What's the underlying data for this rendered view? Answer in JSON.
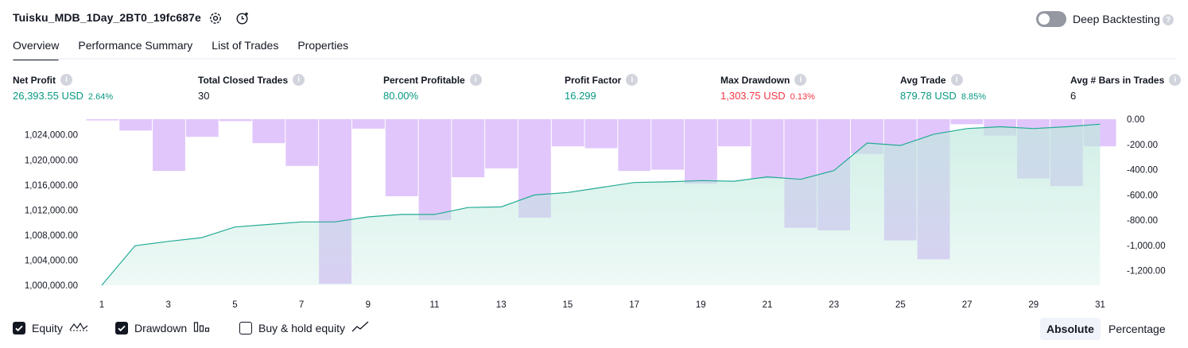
{
  "header": {
    "title": "Tuisku_MDB_1Day_2BT0_19fc687e",
    "deep_backtesting_label": "Deep Backtesting",
    "deep_backtesting_enabled": false
  },
  "tabs": [
    {
      "label": "Overview",
      "active": true
    },
    {
      "label": "Performance Summary",
      "active": false
    },
    {
      "label": "List of Trades",
      "active": false
    },
    {
      "label": "Properties",
      "active": false
    }
  ],
  "metrics": {
    "net_profit": {
      "label": "Net Profit",
      "value": "26,393.55 USD",
      "sub": "2.64%"
    },
    "total_closed_trades": {
      "label": "Total Closed Trades",
      "value": "30"
    },
    "percent_profitable": {
      "label": "Percent Profitable",
      "value": "80.00%"
    },
    "profit_factor": {
      "label": "Profit Factor",
      "value": "16.299"
    },
    "max_drawdown": {
      "label": "Max Drawdown",
      "value": "1,303.75 USD",
      "sub": "0.13%"
    },
    "avg_trade": {
      "label": "Avg Trade",
      "value": "879.78 USD",
      "sub": "8.85%"
    },
    "avg_bars": {
      "label": "Avg # Bars in Trades",
      "value": "6"
    }
  },
  "colors": {
    "equity_line": "#22ab94",
    "equity_fill_top": "#bfe9dd",
    "drawdown_bar": "#e1c6fb",
    "positive": "#089981",
    "negative": "#f23645"
  },
  "chart_data": {
    "type": "line",
    "x": [
      1,
      2,
      3,
      4,
      5,
      6,
      7,
      8,
      9,
      10,
      11,
      12,
      13,
      14,
      15,
      16,
      17,
      18,
      19,
      20,
      21,
      22,
      23,
      24,
      25,
      26,
      27,
      28,
      29,
      30,
      31
    ],
    "xticks": [
      "1",
      "3",
      "5",
      "7",
      "9",
      "11",
      "13",
      "15",
      "17",
      "19",
      "21",
      "23",
      "25",
      "27",
      "29",
      "31"
    ],
    "series": [
      {
        "axis": "left",
        "kind": "area-line",
        "values": [
          1000000,
          1006300,
          1007000,
          1007600,
          1009300,
          1009700,
          1010100,
          1010100,
          1010900,
          1011300,
          1011300,
          1012400,
          1012500,
          1014400,
          1014800,
          1015600,
          1016400,
          1016500,
          1016700,
          1016600,
          1017300,
          1016900,
          1018300,
          1022700,
          1022300,
          1024100,
          1025000,
          1025300,
          1025000,
          1025300,
          1025700
        ]
      },
      {
        "axis": "right",
        "kind": "bar",
        "values": [
          -10,
          -90,
          -410,
          -140,
          -15,
          -190,
          -370,
          -1303.75,
          -75,
          -610,
          -800,
          -460,
          -390,
          -780,
          -215,
          -230,
          -410,
          -400,
          -510,
          -215,
          -470,
          -860,
          -880,
          -275,
          -960,
          -1110,
          -40,
          -130,
          -470,
          -530,
          -215
        ]
      }
    ],
    "yticks_left": [
      "1,000,000.00",
      "1,004,000.00",
      "1,008,000.00",
      "1,012,000.00",
      "1,016,000.00",
      "1,020,000.00",
      "1,024,000.00"
    ],
    "ylim_left": [
      1000000,
      1026500
    ],
    "yticks_right": [
      "0.00",
      "-200.00",
      "-400.00",
      "-600.00",
      "-800.00",
      "-1,000.00",
      "-1,200.00"
    ],
    "ylim_right": [
      -1315,
      0
    ]
  },
  "legend": {
    "equity": {
      "label": "Equity",
      "checked": true
    },
    "drawdown": {
      "label": "Drawdown",
      "checked": true
    },
    "buy_hold": {
      "label": "Buy & hold equity",
      "checked": false
    }
  },
  "view_toggle": {
    "absolute": "Absolute",
    "percentage": "Percentage",
    "active": "absolute"
  }
}
